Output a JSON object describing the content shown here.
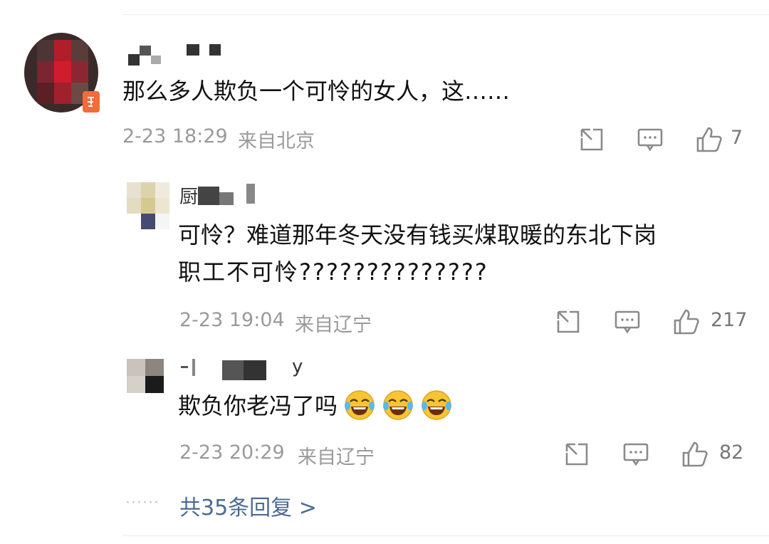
{
  "comments": [
    {
      "text": "那么多人欺负一个可怜的女人，这……",
      "time": "2-23 18:29",
      "location": "来自北京",
      "likes": "7"
    },
    {
      "name_visible": "厨",
      "text_line1": "可怜？难道那年冬天没有钱买煤取暖的东北下岗",
      "text_line2": "职工不可怜??????????????",
      "time": "2-23 19:04",
      "location": "来自辽宁",
      "likes": "217"
    },
    {
      "name_visible": "y",
      "text": "欺负你老冯了吗",
      "emoji": "tears-of-joy",
      "time": "2-23 20:29",
      "location": "来自辽宁",
      "likes": "82"
    }
  ],
  "more_dots": "······",
  "more_replies": "共35条回复 >",
  "colors": {
    "link": "#4c6a93",
    "meta": "#9a9a9a",
    "icon": "#8a8a8a",
    "badge": "#f26b3a"
  }
}
